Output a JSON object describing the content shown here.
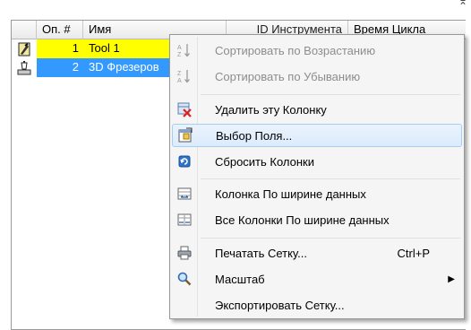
{
  "corner_glyph": "⌅",
  "grid": {
    "columns": [
      "",
      "Оп. #",
      "Имя",
      "ID Инструмента",
      "Время Цикла"
    ],
    "rows": [
      {
        "op": "1",
        "name": "Tool 1",
        "icon": "tool-holder-icon"
      },
      {
        "op": "2",
        "name": "3D Фрезеров",
        "icon": "milling-operation-icon"
      }
    ]
  },
  "menu": {
    "items": [
      {
        "label": "Сортировать по Возрастанию",
        "icon": "sort-ascending-icon",
        "enabled": false
      },
      {
        "label": "Сортировать по Убыванию",
        "icon": "sort-descending-icon",
        "enabled": false
      },
      {
        "label": "Удалить эту Колонку",
        "icon": "delete-column-icon",
        "enabled": true
      },
      {
        "label": "Выбор Поля...",
        "icon": "field-chooser-icon",
        "enabled": true,
        "highlighted": true
      },
      {
        "label": "Сбросить Колонки",
        "icon": "reset-columns-icon",
        "enabled": true
      },
      {
        "label": "Колонка По ширине данных",
        "icon": "best-fit-column-icon",
        "enabled": true
      },
      {
        "label": "Все Колонки По ширине данных",
        "icon": "best-fit-all-columns-icon",
        "enabled": true
      },
      {
        "label": "Печатать Сетку...",
        "icon": "print-icon",
        "enabled": true,
        "shortcut": "Ctrl+P"
      },
      {
        "label": "Масштаб",
        "icon": "zoom-icon",
        "enabled": true,
        "submenu": true
      },
      {
        "label": "Экспортировать Сетку...",
        "icon": "",
        "enabled": true
      }
    ]
  },
  "colors": {
    "row_selected_yellow": "#ffff00",
    "row_selected_blue": "#3399ff",
    "menu_highlight": "#dcebfc"
  }
}
